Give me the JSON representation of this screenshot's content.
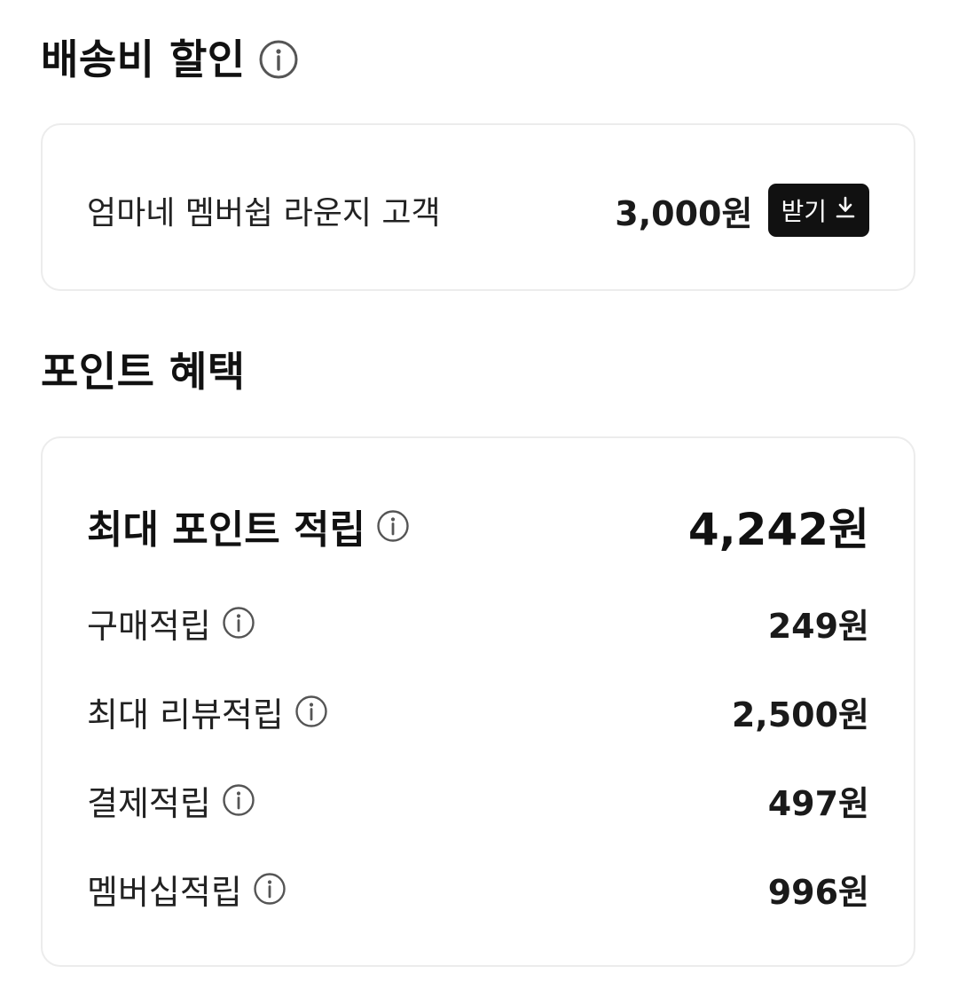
{
  "shipping_discount": {
    "title": "배송비 할인",
    "info_icon": "info-circle-icon",
    "row": {
      "label": "엄마네 멤버쉽 라운지 고객",
      "amount": "3,000원",
      "button_label": "받기",
      "button_icon": "download-icon"
    }
  },
  "point_benefits": {
    "title": "포인트 혜택",
    "max": {
      "label": "최대 포인트 적립",
      "info_icon": "info-circle-icon",
      "amount": "4,242원"
    },
    "items": [
      {
        "label": "구매적립",
        "amount": "249원"
      },
      {
        "label": "최대 리뷰적립",
        "amount": "2,500원"
      },
      {
        "label": "결제적립",
        "amount": "497원"
      },
      {
        "label": "멤버십적립",
        "amount": "996원"
      }
    ]
  },
  "colors": {
    "text": "#111111",
    "button_bg": "#111111",
    "button_text": "#ffffff",
    "card_border": "#ececec",
    "icon_stroke": "#555555"
  }
}
